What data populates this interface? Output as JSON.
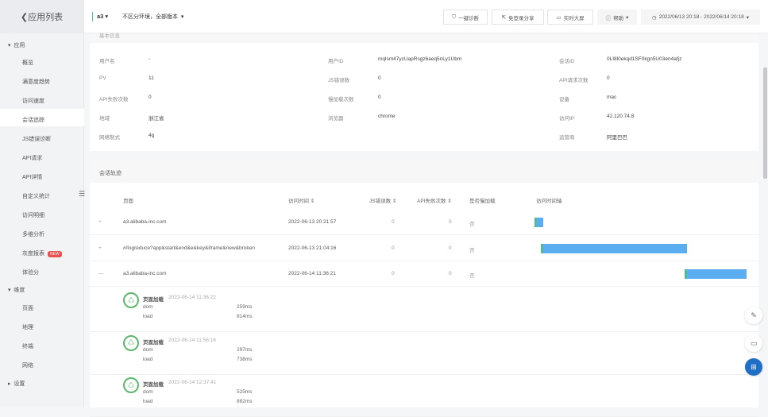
{
  "sidebar": {
    "back": "应用列表",
    "group_app": "应用",
    "items": [
      "概览",
      "满意度趋势",
      "访问速度",
      "会话追踪",
      "JS错误诊断",
      "API请求",
      "API详情",
      "自定义统计",
      "访问明细",
      "多维分析",
      "灰度报表",
      "体验分"
    ],
    "new_badge": "NEW",
    "group_dim": "维度",
    "dim_items": [
      "页面",
      "地理",
      "终端",
      "网络"
    ],
    "group_settings": "设置"
  },
  "topbar": {
    "app": "a3",
    "env": "不区分环境，全部版本",
    "diagnose": "一键诊断",
    "share": "免登录分享",
    "screen": "实时大屏",
    "help": "帮助",
    "range": "2022/06/13 20:18 - 2022/06/14 20:18"
  },
  "info": {
    "title": "基本信息",
    "fields": [
      {
        "label": "用户名",
        "value": "-"
      },
      {
        "label": "用户ID",
        "value": "mqlsm47ycUapRsgz6aeq5nLy1Ubm"
      },
      {
        "label": "会话ID",
        "value": "0LI8l0ekqd1SF0kgn5U03en4afjz"
      },
      {
        "label": "PV",
        "value": "11"
      },
      {
        "label": "JS错误数",
        "value": "0"
      },
      {
        "label": "API请求次数",
        "value": "0"
      },
      {
        "label": "API失败次数",
        "value": "0"
      },
      {
        "label": "慢加载次数",
        "value": "0"
      },
      {
        "label": "设备",
        "value": "mac"
      },
      {
        "label": "地域",
        "value": "浙江省"
      },
      {
        "label": "浏览器",
        "value": "chrome"
      },
      {
        "label": "访问IP",
        "value": "42.120.74.8"
      },
      {
        "label": "网络制式",
        "value": "4g"
      },
      {
        "label": "",
        "value": ""
      },
      {
        "label": "运营商",
        "value": "阿里巴巴"
      }
    ]
  },
  "trace": {
    "title": "会话轨迹",
    "headers": [
      "页面",
      "访问时间 ⇕",
      "JS错误数 ⇕",
      "API失败次数 ⇕",
      "是否慢加载",
      "访问时间轴"
    ],
    "rows": [
      {
        "toggle": "+",
        "page": "a3.alibaba-inc.com",
        "time": "2022-06-13 20:21:57",
        "js": "0",
        "api": "0",
        "slow": "否",
        "start": 0,
        "end": 0.04
      },
      {
        "toggle": "+",
        "page": "#/logreduce?app&start&end&e&key&iframe&new&broken",
        "time": "2022-06-13 21:04:16",
        "js": "0",
        "api": "0",
        "slow": "否",
        "start": 0.03,
        "end": 0.71
      },
      {
        "toggle": "—",
        "page": "a3.alibaba-inc.com",
        "time": "2022-06-14 11:36:21",
        "js": "0",
        "api": "0",
        "slow": "否",
        "start": 0.7,
        "end": 0.99
      }
    ],
    "events": [
      {
        "title": "页面加载",
        "time": "2022-06-14 11:36:22",
        "dom_label": "dom",
        "dom": "259ms",
        "load_label": "load",
        "load": "814ms"
      },
      {
        "title": "页面加载",
        "time": "2022-06-14 11:56:16",
        "dom_label": "dom",
        "dom": "297ms",
        "load_label": "load",
        "load": "738ms"
      },
      {
        "title": "页面加载",
        "time": "2022-06-14 12:37:41",
        "dom_label": "dom",
        "dom": "525ms",
        "load_label": "load",
        "load": "882ms"
      }
    ]
  },
  "colors": {
    "bar": "#5aaef0",
    "start": "#4cc06a",
    "fab": "#1f6fc5"
  }
}
